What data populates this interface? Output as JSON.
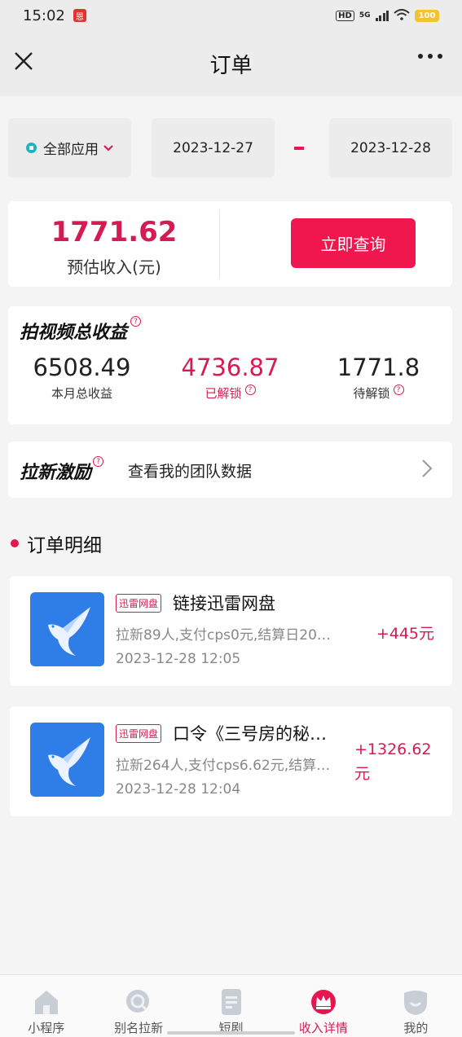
{
  "status_bar": {
    "time": "15:02",
    "app_badge": "恩",
    "hd": "HD",
    "network": "5G",
    "battery": "100"
  },
  "nav": {
    "title": "订单"
  },
  "filter": {
    "app_label": "全部应用",
    "date_start": "2023-12-27",
    "date_end": "2023-12-28"
  },
  "income": {
    "value": "1771.62",
    "label": "预估收入(元)",
    "query_button": "立即查询"
  },
  "earnings": {
    "title": "拍视频总收益",
    "help": "?",
    "items": [
      {
        "value": "6508.49",
        "label": "本月总收益"
      },
      {
        "value": "4736.87",
        "label": "已解锁"
      },
      {
        "value": "1771.8",
        "label": "待解锁"
      }
    ]
  },
  "team": {
    "title": "拉新激励",
    "text": "查看我的团队数据"
  },
  "orders_section": {
    "title": "订单明细"
  },
  "orders": [
    {
      "tag": "迅雷网盘",
      "name": "链接迅雷网盘",
      "desc": "拉新89人,支付cps0元,结算日20…",
      "time": "2023-12-28 12:05",
      "amount": "+445元"
    },
    {
      "tag": "迅雷网盘",
      "name": "口令《三号房的秘…",
      "desc": "拉新264人,支付cps6.62元,结算…",
      "time": "2023-12-28 12:04",
      "amount_line1": "+1326.62",
      "amount_line2": "元"
    }
  ],
  "tabbar": [
    {
      "label": "小程序",
      "icon": "home-icon"
    },
    {
      "label": "别名拉新",
      "icon": "search-icon"
    },
    {
      "label": "短剧",
      "icon": "document-icon"
    },
    {
      "label": "收入详情",
      "icon": "crown-badge-icon",
      "active": true
    },
    {
      "label": "我的",
      "icon": "profile-icon"
    }
  ],
  "colors": {
    "accent": "#e8164f",
    "accent_text": "#d41c52",
    "icon_blue": "#2f7ee8"
  }
}
